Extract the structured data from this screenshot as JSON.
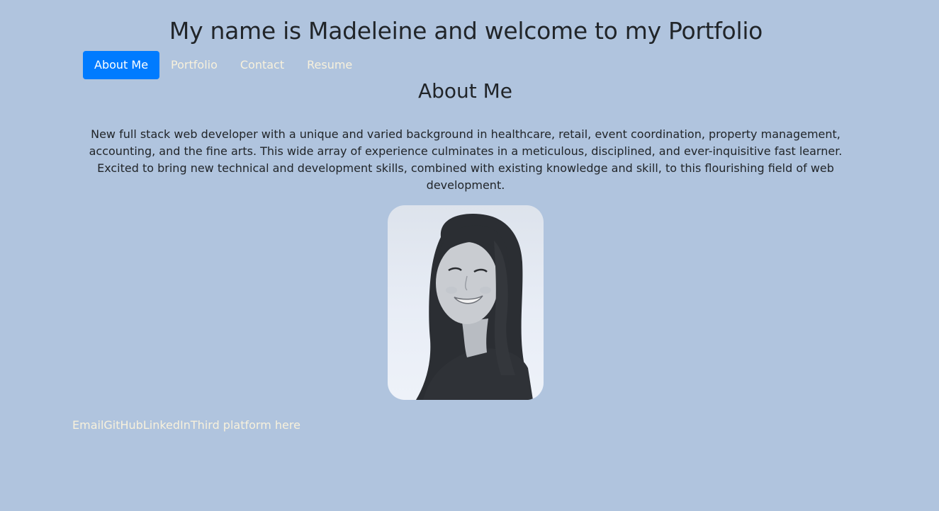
{
  "header": {
    "title": "My name is Madeleine and welcome to my Portfolio"
  },
  "nav": {
    "items": [
      {
        "label": "About Me",
        "active": true
      },
      {
        "label": "Portfolio",
        "active": false
      },
      {
        "label": "Contact",
        "active": false
      },
      {
        "label": "Resume",
        "active": false
      }
    ]
  },
  "about": {
    "heading": "About Me",
    "bio": "New full stack web developer with a unique and varied background in healthcare, retail, event coordination, property management, accounting, and the fine arts. This wide array of experience culminates in a meticulous, disciplined, and ever-inquisitive fast learner. Excited to bring new technical and development skills, combined with existing knowledge and skill, to this flourishing field of web development."
  },
  "footer": {
    "links": [
      "Email",
      "GitHub",
      "LinkedIn",
      "Third platform here"
    ]
  },
  "colors": {
    "background": "#b0c4de",
    "active_nav": "#007bff",
    "link_text": "#f8f1dc",
    "body_text": "#212529"
  }
}
